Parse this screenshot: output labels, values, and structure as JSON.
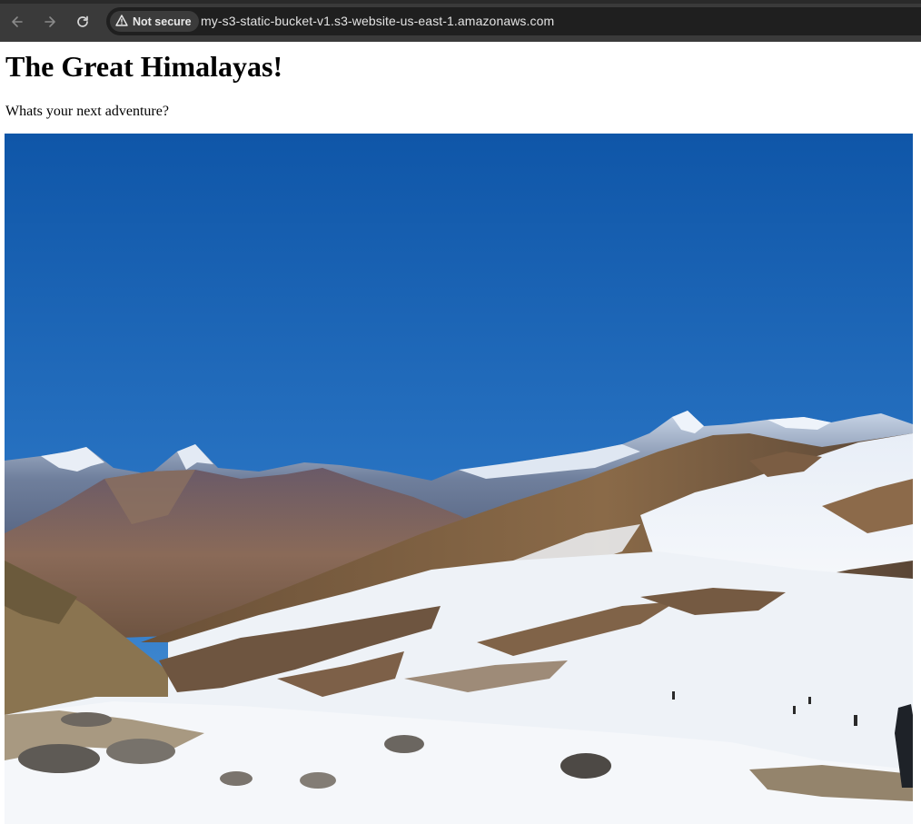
{
  "browser": {
    "security_label": "Not secure",
    "url": "my-s3-static-bucket-v1.s3-website-us-east-1.amazonaws.com",
    "icons": {
      "back": "arrow-left-icon",
      "forward": "arrow-right-icon",
      "reload": "reload-icon",
      "security": "warning-triangle-icon"
    },
    "colors": {
      "toolbar": "#3a3a3a",
      "omnibox": "#1f1f1f",
      "text": "#e3e3e3"
    }
  },
  "page": {
    "heading": "The Great Himalayas!",
    "subtitle": "Whats your next adventure?"
  },
  "image": {
    "colors": {
      "sky_top": "#0f56a8",
      "sky_bottom": "#3d8bd6",
      "snow": "#f2f4f8",
      "rock": "#7a5c45"
    }
  }
}
